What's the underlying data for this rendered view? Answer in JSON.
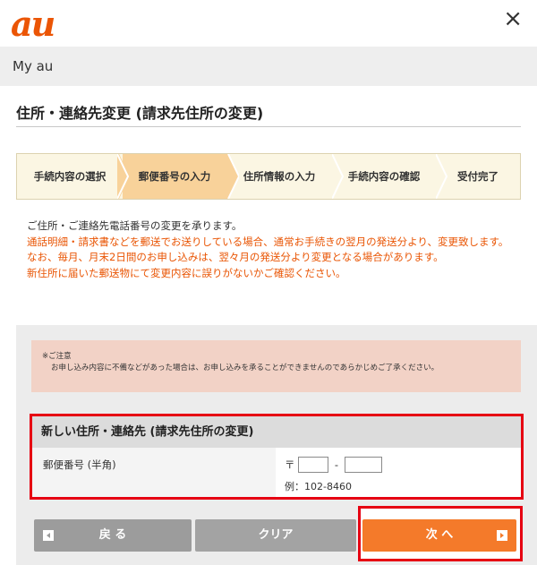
{
  "header": {
    "logo": "au",
    "close_glyph": "×"
  },
  "nav": {
    "label": "My au"
  },
  "page": {
    "title": "住所・連絡先変更 (請求先住所の変更)"
  },
  "steps": [
    {
      "label": "手続内容の選択",
      "active": false
    },
    {
      "label": "郵便番号の入力",
      "active": true
    },
    {
      "label": "住所情報の入力",
      "active": false
    },
    {
      "label": "手続内容の確認",
      "active": false
    },
    {
      "label": "受付完了",
      "active": false
    }
  ],
  "intro": {
    "line1": "ご住所・ご連絡先電話番号の変更を承ります。",
    "line2": "通話明細・請求書などを郵送でお送りしている場合、通常お手続きの翌月の発送分より、変更致します。",
    "line3": "なお、毎月、月末2日間のお申し込みは、翌々月の発送分より変更となる場合があります。",
    "line4": "新住所に届いた郵送物にて変更内容に誤りがないかご確認ください。"
  },
  "notice": {
    "heading": "※ご注意",
    "body": "お申し込み内容に不備などがあった場合は、お申し込みを承ることができませんのであらかじめご了承ください。"
  },
  "address_form": {
    "heading": "新しい住所・連絡先 (請求先住所の変更)",
    "zip_label": "郵便番号 (半角)",
    "zip_mark": "〒",
    "zip_separator": "-",
    "zip_first_value": "",
    "zip_second_value": "",
    "zip_example": "例：102-8460"
  },
  "buttons": {
    "back": "戻 る",
    "clear": "クリア",
    "next": "次 へ"
  },
  "colors": {
    "brand": "#eb5505",
    "accent_orange": "#e95504",
    "next_button": "#f47a2a",
    "highlight_border": "#e60012",
    "active_step": "#f8d29a"
  },
  "icons": {
    "back_button": "arrow-left-icon",
    "next_button": "arrow-right-icon",
    "close": "close-icon"
  }
}
